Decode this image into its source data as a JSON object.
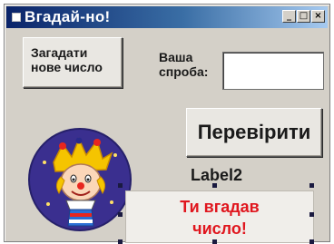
{
  "window": {
    "title": "Вгадай-но!",
    "controls": {
      "minimize": "_",
      "maximize": "□",
      "close": "×"
    }
  },
  "buttons": {
    "new_number_line1": "Загадати",
    "new_number_line2": "нове число",
    "check": "Перевірити"
  },
  "attempt": {
    "label_line1": "Ваша",
    "label_line2": "спроба:",
    "value": ""
  },
  "label2": "Label2",
  "result": {
    "line1": "Ти вгадав",
    "line2": "число!"
  },
  "picture": {
    "icon": "clown-icon"
  },
  "colors": {
    "title_start": "#0a246a",
    "result_text": "#e0161e",
    "face_bg": "#3a2f8f"
  }
}
